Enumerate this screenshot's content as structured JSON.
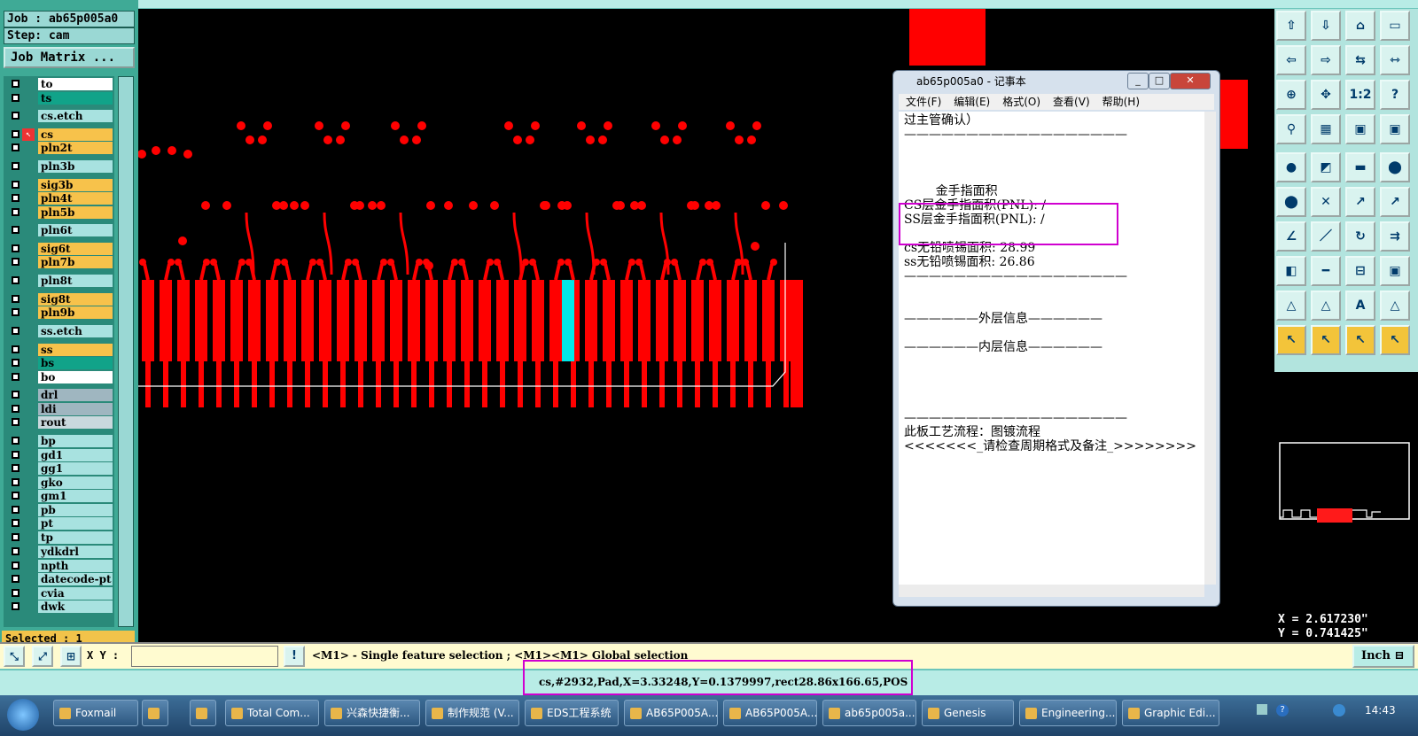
{
  "job": {
    "job_line": "Job : ab65p005a0",
    "step_line": "Step: cam",
    "matrix_button": "Job Matrix ..."
  },
  "layers": [
    {
      "name": "to",
      "color": "#ffffff"
    },
    {
      "name": "ts",
      "color": "#11a389"
    },
    {
      "name": "cs.etch",
      "color": "#a8e2e0"
    },
    {
      "name": "cs",
      "color": "#f7c24b",
      "active": true
    },
    {
      "name": "pln2t",
      "color": "#f7c24b"
    },
    {
      "name": "pln3b",
      "color": "#a8e2e0"
    },
    {
      "name": "sig3b",
      "color": "#f7c24b"
    },
    {
      "name": "pln4t",
      "color": "#f7c24b"
    },
    {
      "name": "pln5b",
      "color": "#f7c24b"
    },
    {
      "name": "pln6t",
      "color": "#a8e2e0"
    },
    {
      "name": "sig6t",
      "color": "#f7c24b"
    },
    {
      "name": "pln7b",
      "color": "#f7c24b"
    },
    {
      "name": "pln8t",
      "color": "#a8e2e0"
    },
    {
      "name": "sig8t",
      "color": "#f7c24b"
    },
    {
      "name": "pln9b",
      "color": "#f7c24b"
    },
    {
      "name": "ss.etch",
      "color": "#a8e2e0"
    },
    {
      "name": "ss",
      "color": "#f7c24b"
    },
    {
      "name": "bs",
      "color": "#11a389"
    },
    {
      "name": "bo",
      "color": "#ffffff"
    },
    {
      "name": "drl",
      "color": "#9fb6c0"
    },
    {
      "name": "ldi",
      "color": "#9fb6c0"
    },
    {
      "name": "rout",
      "color": "#c9d8dd"
    },
    {
      "name": "bp",
      "color": "#a8e2e0"
    },
    {
      "name": "gd1",
      "color": "#a8e2e0"
    },
    {
      "name": "gg1",
      "color": "#a8e2e0"
    },
    {
      "name": "gko",
      "color": "#a8e2e0"
    },
    {
      "name": "gm1",
      "color": "#a8e2e0"
    },
    {
      "name": "pb",
      "color": "#a8e2e0"
    },
    {
      "name": "pt",
      "color": "#a8e2e0"
    },
    {
      "name": "tp",
      "color": "#a8e2e0"
    },
    {
      "name": "ydkdrl",
      "color": "#a8e2e0"
    },
    {
      "name": "npth",
      "color": "#a8e2e0"
    },
    {
      "name": "datecode-pt",
      "color": "#a8e2e0"
    },
    {
      "name": "cvia",
      "color": "#a8e2e0"
    },
    {
      "name": "dwk",
      "color": "#a8e2e0"
    }
  ],
  "selected_text": "Selected : 1",
  "command_bar": {
    "xy_label": "X Y :",
    "xy_value": "",
    "hint": "<M1> - Single feature selection ; <M1><M1> Global selection",
    "units": "Inch"
  },
  "status_text": "cs,#2932,Pad,X=3.33248,Y=0.1379997,rect28.86x166.65,POS",
  "coords": {
    "x": "X = 2.617230\"",
    "y": "Y = 0.741425\""
  },
  "notepad": {
    "title": "ab65p005a0 - 记事本",
    "menu": [
      "文件(F)",
      "编辑(E)",
      "格式(O)",
      "查看(V)",
      "帮助(H)"
    ],
    "lines": [
      "过主管确认）",
      "——————————————————",
      "",
      "",
      "",
      "        金手指面积",
      "CS层金手指面积(PNL): /",
      "SS层金手指面积(PNL): /",
      "",
      "cs无铅喷锡面积: 28.99",
      "ss无铅喷锡面积: 26.86",
      "——————————————————",
      "",
      "",
      "——————外层信息——————",
      "",
      "——————内层信息——————",
      "",
      "",
      "",
      "",
      "——————————————————",
      "此板工艺流程：图镀流程",
      "<<<<<<<_请检查周期格式及备注_>>>>>>>>"
    ]
  },
  "taskbar": {
    "items": [
      "Foxmail",
      "",
      "",
      "Total Com...",
      "兴森快捷衡...",
      "制作规范 (V...",
      "EDS工程系统",
      "AB65P005A...",
      "AB65P005A...",
      "ab65p005a...",
      "Genesis",
      "Engineering...",
      "Graphic Edi..."
    ],
    "clock": "14:43"
  }
}
